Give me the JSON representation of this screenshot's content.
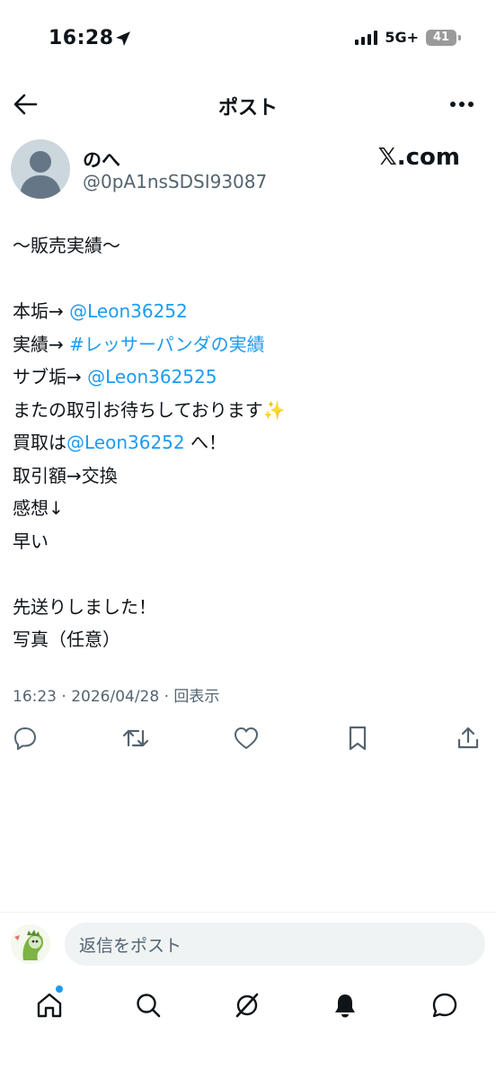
{
  "status_bar": {
    "time": "16:28",
    "network": "5G+",
    "battery": "41",
    "icons": [
      "location-arrow-icon",
      "signal-icon",
      "battery-icon"
    ]
  },
  "header": {
    "title": "ポスト",
    "icons": [
      "back-arrow-icon",
      "more-icon"
    ]
  },
  "post": {
    "author": {
      "display_name": "のへ",
      "handle": "@0pA1nsSDSI93087"
    },
    "brand": "𝕏.com",
    "lines": [
      [
        {
          "text": "〜販売実績〜"
        }
      ],
      [],
      [
        {
          "text": "本垢→ "
        },
        {
          "text": "@Leon36252",
          "link": true
        }
      ],
      [
        {
          "text": "実績→ "
        },
        {
          "text": "#レッサーパンダの実績",
          "link": true
        }
      ],
      [
        {
          "text": "サブ垢→ "
        },
        {
          "text": "@Leon362525",
          "link": true
        }
      ],
      [
        {
          "text": "またの取引お待ちしております"
        },
        {
          "text": "✨",
          "emoji": true
        }
      ],
      [
        {
          "text": "買取は"
        },
        {
          "text": "@Leon36252",
          "link": true
        },
        {
          "text": " へ！"
        }
      ],
      [
        {
          "text": "取引額→交換"
        }
      ],
      [
        {
          "text": "感想↓"
        }
      ],
      [
        {
          "text": "早い"
        }
      ],
      [],
      [
        {
          "text": "先送りしました！"
        }
      ],
      [
        {
          "text": "写真（任意）"
        }
      ]
    ],
    "meta": "16:23 · 2026/04/28 · 回表示"
  },
  "actions": [
    "reply-icon",
    "repost-icon",
    "like-icon",
    "bookmark-icon",
    "share-icon"
  ],
  "reply_bar": {
    "placeholder": "返信をポスト"
  },
  "tab_bar": [
    "home-icon",
    "search-icon",
    "grok-icon",
    "notifications-icon",
    "messages-icon"
  ],
  "colors": {
    "link": "#1d9bf0",
    "text": "#0f1419",
    "secondary": "#536471",
    "divider": "#eff3f4"
  }
}
